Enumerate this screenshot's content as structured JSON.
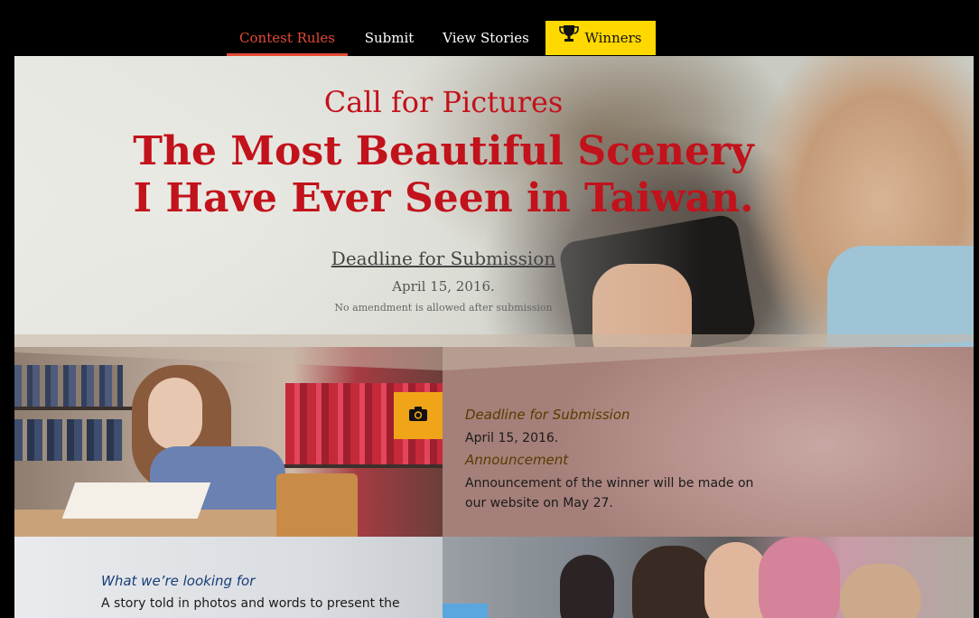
{
  "nav": {
    "items": [
      {
        "label": "Contest Rules",
        "active": true
      },
      {
        "label": "Submit",
        "active": false
      },
      {
        "label": "View Stories",
        "active": false
      }
    ],
    "winners": {
      "label": "Winners",
      "icon": "trophy-icon",
      "bg": "#ffd800"
    }
  },
  "hero": {
    "kicker": "Call for Pictures",
    "headline_line1": "The Most Beautiful Scenery",
    "headline_line2": "I Have Ever Seen in Taiwan.",
    "deadline_label": "Deadline for Submission",
    "deadline_date": "April 15, 2016.",
    "deadline_note": "No amendment is allowed after submission"
  },
  "info": {
    "camera_icon": "camera-icon",
    "deadline_title": "Deadline for Submission",
    "deadline_date": "April 15, 2016.",
    "announcement_title": "Announcement",
    "announcement_text": "Announcement of the winner will be made on our website on May 27."
  },
  "looking": {
    "title": "What we’re looking for",
    "text": "A story told in photos and words to present the"
  },
  "colors": {
    "accent_red": "#c2121b",
    "nav_active": "#e44a35",
    "badge_orange": "#f0a518",
    "winners_yellow": "#ffd800"
  }
}
